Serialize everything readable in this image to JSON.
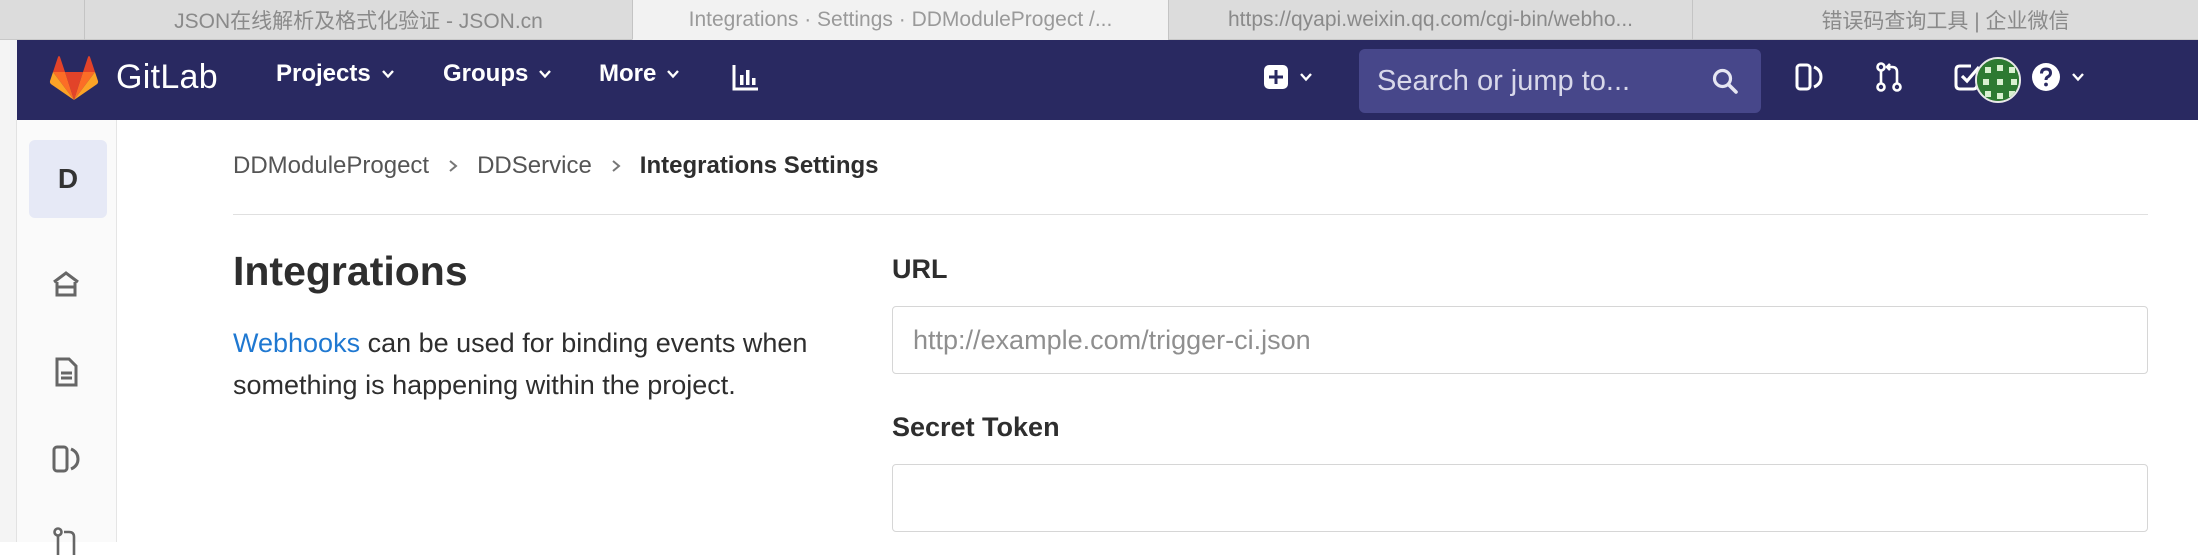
{
  "browser": {
    "tabs": [
      {
        "title": "JSON在线解析及格式化验证 - JSON.cn",
        "active": false
      },
      {
        "title": "Integrations · Settings · DDModuleProgect /...",
        "active": true
      },
      {
        "title": "https://qyapi.weixin.qq.com/cgi-bin/webho...",
        "active": false
      },
      {
        "title": "错误码查询工具 | 企业微信",
        "active": false
      }
    ]
  },
  "navbar": {
    "brand": "GitLab",
    "projects_label": "Projects",
    "groups_label": "Groups",
    "more_label": "More",
    "search_placeholder": "Search or jump to...",
    "colors": {
      "background": "#292961",
      "search_bg": "#47478a"
    }
  },
  "sidebar": {
    "project_initial": "D",
    "icons": [
      "home-icon",
      "file-icon",
      "merge-request-icon",
      "cicd-icon"
    ]
  },
  "breadcrumb": {
    "items": [
      "DDModuleProgect",
      "DDService"
    ],
    "current": "Integrations Settings"
  },
  "main": {
    "title": "Integrations",
    "description_link": "Webhooks",
    "description_rest": " can be used for binding events when something is happening within the project.",
    "url_label": "URL",
    "url_placeholder": "http://example.com/trigger-ci.json",
    "url_value": "",
    "secret_label": "Secret Token",
    "secret_value": ""
  }
}
